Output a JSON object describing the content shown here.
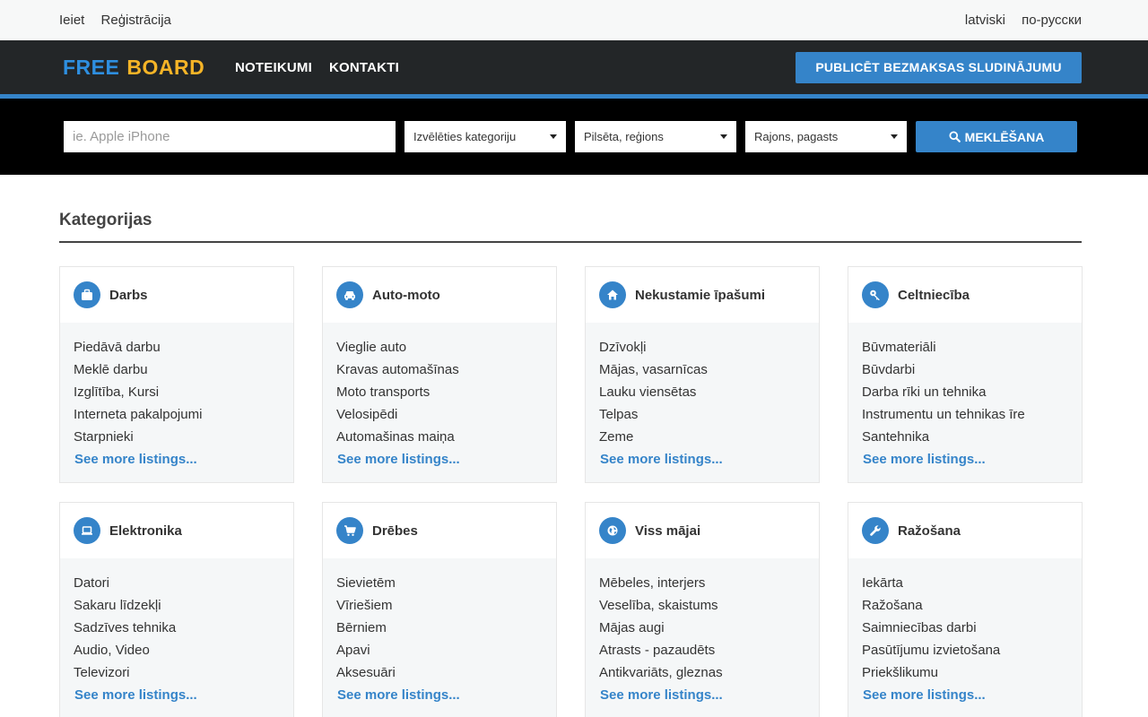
{
  "topbar": {
    "login": "Ieiet",
    "register": "Reģistrācija",
    "lang_lv": "latviski",
    "lang_ru": "по-русски"
  },
  "nav": {
    "logo_free": "FREE",
    "logo_board": "BOARD",
    "rules": "NOTEIKUMI",
    "contacts": "KONTAKTI",
    "publish": "PUBLICĒT BEZMAKSAS SLUDINĀJUMU"
  },
  "search": {
    "placeholder": "ie. Apple iPhone",
    "category": "Izvēlēties kategoriju",
    "city": "Pilsēta, reģions",
    "district": "Rajons, pagasts",
    "button": "MEKLĒŠANA"
  },
  "section_title": "Kategorijas",
  "see_more": "See more listings...",
  "categories": [
    {
      "title": "Darbs",
      "icon": "briefcase-icon",
      "items": [
        "Piedāvā darbu",
        "Meklē darbu",
        "Izglītība, Kursi",
        "Interneta pakalpojumi",
        "Starpnieki"
      ]
    },
    {
      "title": "Auto-moto",
      "icon": "car-icon",
      "items": [
        "Vieglie auto",
        "Kravas automašīnas",
        "Moto transports",
        "Velosipēdi",
        "Automašinas maiņa"
      ]
    },
    {
      "title": "Nekustamie īpašumi",
      "icon": "home-icon",
      "items": [
        "Dzīvokļi",
        "Mājas, vasarnīcas",
        "Lauku viensētas",
        "Telpas",
        "Zeme"
      ]
    },
    {
      "title": "Celtniecība",
      "icon": "key-icon",
      "items": [
        "Būvmateriāli",
        "Būvdarbi",
        "Darba rīki un tehnika",
        "Instrumentu un tehnikas īre",
        "Santehnika"
      ]
    },
    {
      "title": "Elektronika",
      "icon": "laptop-icon",
      "items": [
        "Datori",
        "Sakaru līdzekļi",
        "Sadzīves tehnika",
        "Audio, Video",
        "Televizori"
      ]
    },
    {
      "title": "Drēbes",
      "icon": "cart-icon",
      "items": [
        "Sievietēm",
        "Vīriešiem",
        "Bērniem",
        "Apavi",
        "Aksesuāri"
      ]
    },
    {
      "title": "Viss mājai",
      "icon": "globe-icon",
      "items": [
        "Mēbeles, interjers",
        "Veselība, skaistums",
        "Mājas augi",
        "Atrasts - pazaudēts",
        "Antikvariāts, gleznas"
      ]
    },
    {
      "title": "Ražošana",
      "icon": "wrench-icon",
      "items": [
        "Iekārta",
        "Ražošana",
        "Saimniecības darbi",
        "Pasūtījumu izvietošana",
        "Priekšlikumu"
      ]
    }
  ],
  "colors": {
    "accent": "#3584c9",
    "logo_blue": "#2e8fe0",
    "logo_yellow": "#f5b427",
    "nav_bg": "#232628"
  }
}
